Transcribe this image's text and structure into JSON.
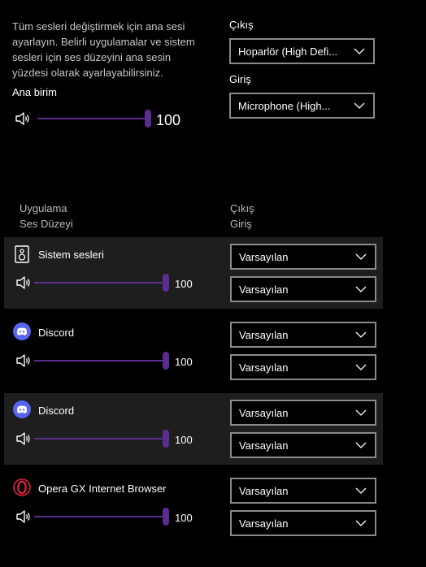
{
  "master": {
    "description_lines": [
      "Tüm sesleri değiştirmek için ana sesi",
      "ayarlayın. Belirli uygulamalar ve sistem",
      "sesleri için ses düzeyini ana sesin",
      "yüzdesi olarak ayarlayabilirsiniz."
    ],
    "volume_label": "Ana birim",
    "volume_value": "100",
    "volume_level": 1.0
  },
  "output": {
    "label": "Çıkış",
    "value": "Hoparlör (High Defi..."
  },
  "input": {
    "label": "Giriş",
    "value": "Microphone (High..."
  },
  "headers": {
    "app": "Uygulama",
    "level": "Ses Düzeyi",
    "output": "Çıkış",
    "input": "Giriş"
  },
  "apps": [
    {
      "name": "Sistem sesleri",
      "icon": "system-sounds-icon",
      "volume": "100",
      "level": 1.0,
      "output": "Varsayılan",
      "input": "Varsayılan",
      "highlighted": true
    },
    {
      "name": "Discord",
      "icon": "discord-icon",
      "volume": "100",
      "level": 1.0,
      "output": "Varsayılan",
      "input": "Varsayılan",
      "highlighted": false
    },
    {
      "name": "Discord",
      "icon": "discord-icon",
      "volume": "100",
      "level": 1.0,
      "output": "Varsayılan",
      "input": "Varsayılan",
      "highlighted": true
    },
    {
      "name": "Opera GX Internet Browser",
      "icon": "opera-gx-icon",
      "volume": "100",
      "level": 1.0,
      "output": "Varsayılan",
      "input": "Varsayılan",
      "highlighted": false
    }
  ],
  "colors": {
    "accent": "#5c2d91",
    "row_highlight": "#1e1e1e",
    "discord": "#5865f2",
    "opera": "#e0243a"
  }
}
